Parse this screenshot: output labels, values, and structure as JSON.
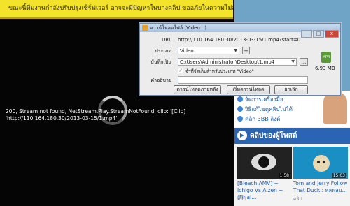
{
  "player": {
    "notice": "ขณะนี้ทีมงานกำลังปรับปรุงเซิร์ฟเวอร์ อาจจะมีปัญหาในบางคลิป ขออภัยในความไม่สะดวกค่ะ",
    "error": "200, Stream not found, NetStream.Play.StreamNotFound, clip: '[Clip] 'http://110.164.180.30/2013-03-15/1.mp4''"
  },
  "dialog": {
    "title": "ดาวน์โหลดไฟล์ (Video...)",
    "url_label": "URL",
    "url_value": "http://110.164.180.30/2013-03-15/1.mp4?start=0",
    "category_label": "ประเภท",
    "category_value": "Video",
    "add_label": "+",
    "saveto_label": "บันทึกเป็น",
    "saveto_value": "C:\\Users\\Administrator\\Desktop\\1.mp4",
    "browse_label": "...",
    "remember_label": "จำที่จัดเก็บสำหรับประเภท \"Video\"",
    "remember_checked": true,
    "desc_label": "คำอธิบาย",
    "desc_value": "",
    "file_type": "MP4",
    "file_size": "6.93 MB",
    "later_button": "ดาวน์โหลดภายหลัง",
    "start_button": "เริ่มดาวน์โหลด",
    "cancel_button": "ยกเลิก",
    "window_buttons": [
      "_",
      "□",
      "x"
    ]
  },
  "side": {
    "promo_lines": [
      "จัดการเครื่องมือ",
      "วิธีแก้ไขดูคลิปไม่ได้",
      "คลิก 3BB ลิงค์"
    ],
    "section_title": "คลิปของผู้โพสต์",
    "videos": [
      {
        "title": "[Bleach AMV] ~ Ichigo Vs Aizen ~ (Final...",
        "duration": "1:58",
        "meta": "คลิป"
      },
      {
        "title": "Tom and Jerry Follow That Duck : พลพลม...",
        "duration": "15:03",
        "meta": "คลิป"
      }
    ]
  }
}
